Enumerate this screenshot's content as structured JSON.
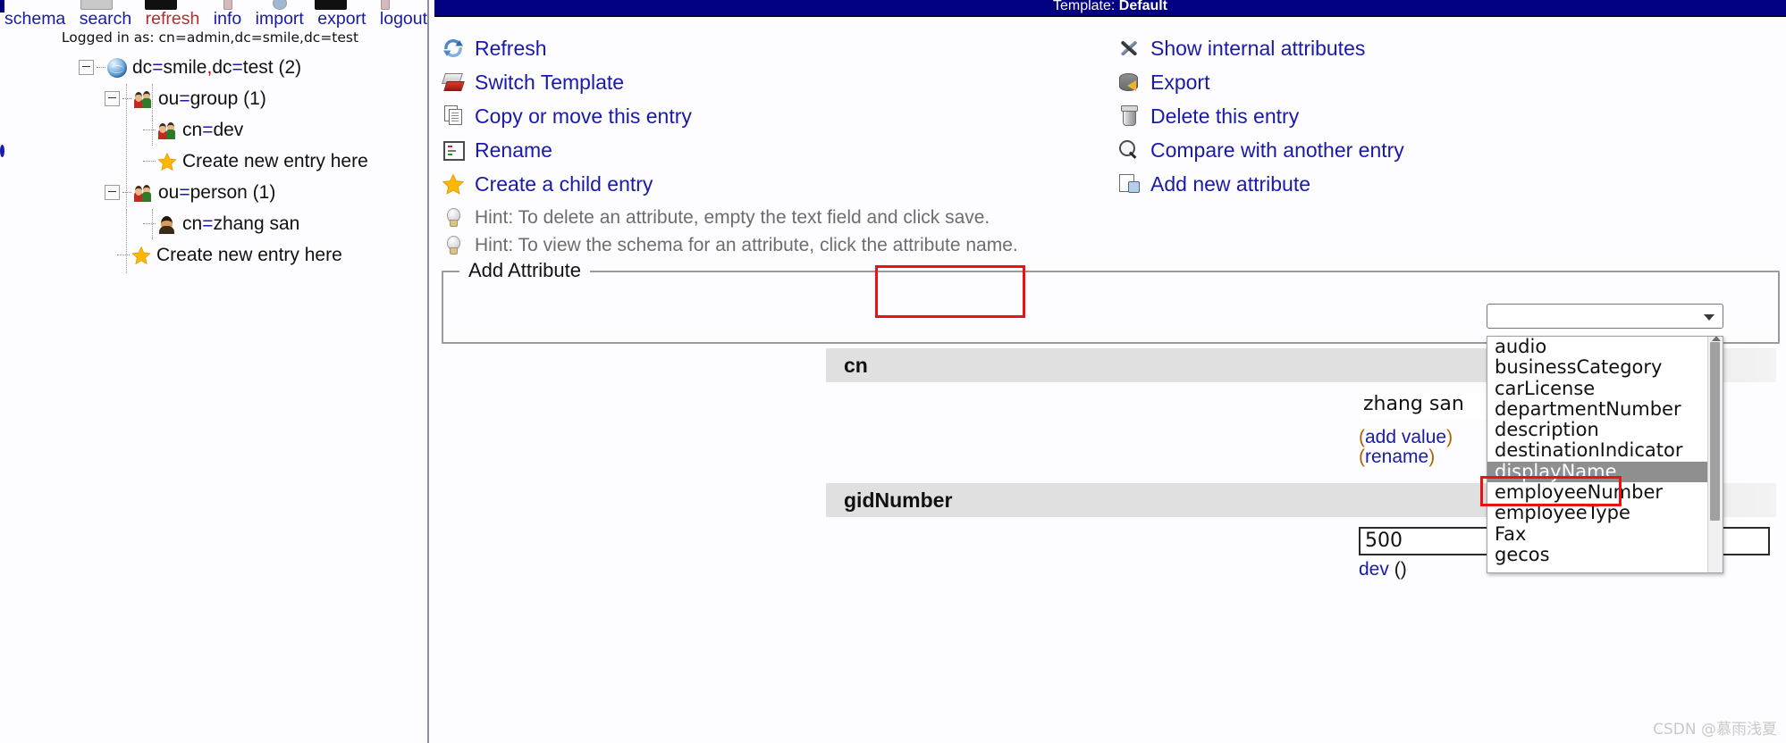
{
  "app": {
    "title_bar": "Template: Default",
    "title_prefix": "Template: ",
    "template_name": "Default"
  },
  "sidebar": {
    "nav_links": [
      {
        "label": "schema",
        "state": "normal"
      },
      {
        "label": "search",
        "state": "normal"
      },
      {
        "label": "refresh",
        "state": "active"
      },
      {
        "label": "info",
        "state": "normal"
      },
      {
        "label": "import",
        "state": "normal"
      },
      {
        "label": "export",
        "state": "normal"
      },
      {
        "label": "logout",
        "state": "normal"
      }
    ],
    "logged_in_as": "Logged in as: cn=admin,dc=smile,dc=test",
    "tree": [
      {
        "id": "root",
        "icon": "globe-icon",
        "label": "dc=smile,dc=test (2)",
        "depth": 0,
        "expander": true
      },
      {
        "id": "ou-group",
        "icon": "group-icon",
        "label": "ou=group (1)",
        "depth": 1,
        "expander": true
      },
      {
        "id": "cn-dev",
        "icon": "group-icon",
        "label": "cn=dev",
        "depth": 2,
        "expander": false
      },
      {
        "id": "create-1",
        "icon": "star-icon",
        "label": "Create new entry here",
        "depth": 2,
        "expander": false
      },
      {
        "id": "ou-person",
        "icon": "group-icon",
        "label": "ou=person (1)",
        "depth": 1,
        "expander": true
      },
      {
        "id": "cn-zhangsan",
        "icon": "person-icon",
        "label": "cn=zhang san",
        "depth": 2,
        "expander": false
      },
      {
        "id": "create-2",
        "icon": "star-icon",
        "label": "Create new entry here",
        "depth": 1,
        "expander": false
      }
    ]
  },
  "main": {
    "actions_left": [
      {
        "icon": "refresh-icon",
        "label": "Refresh"
      },
      {
        "icon": "template-icon",
        "label": "Switch Template"
      },
      {
        "icon": "copy-icon",
        "label": "Copy or move this entry"
      },
      {
        "icon": "rename-icon",
        "label": "Rename"
      },
      {
        "icon": "star-icon",
        "label": "Create a child entry"
      }
    ],
    "actions_right": [
      {
        "icon": "tools-icon",
        "label": "Show internal attributes"
      },
      {
        "icon": "export-icon",
        "label": "Export"
      },
      {
        "icon": "trash-icon",
        "label": "Delete this entry"
      },
      {
        "icon": "magnifier-icon",
        "label": "Compare with another entry"
      },
      {
        "icon": "add-attr-icon",
        "label": "Add new attribute"
      }
    ],
    "hints": [
      {
        "icon": "bulb-icon",
        "text": "Hint: To delete an attribute, empty the text field and click save."
      },
      {
        "icon": "bulb-icon",
        "text": "Hint: To view the schema for an attribute, click the attribute name."
      }
    ],
    "add_attribute": {
      "legend": "Add Attribute",
      "select_value": "",
      "select_placeholder": "",
      "options": [
        "audio",
        "businessCategory",
        "carLicense",
        "departmentNumber",
        "description",
        "destinationIndicator",
        "displayName",
        "employeeNumber",
        "employeeType",
        "Fax",
        "gecos"
      ],
      "selected_option": "displayName"
    },
    "attributes": [
      {
        "name": "cn",
        "value": "zhang san",
        "add_value_label": "add value",
        "rename_label": "rename",
        "open_paren": "(",
        "close_paren": ")"
      },
      {
        "name": "gidNumber",
        "value": "500",
        "sub_label": "dev",
        "sub_suffix": "()"
      }
    ]
  },
  "watermark": "CSDN @慕雨浅夏",
  "colors": {
    "title_bar_bg": "#000080",
    "link": "#1a1aa8",
    "highlight_red": "#ee1111",
    "hint_gray": "#6d6d6d",
    "attr_header_bg": "#e0e0e0",
    "dropdown_selected_bg": "#8f8f8f",
    "star_yellow": "#ffb800"
  }
}
